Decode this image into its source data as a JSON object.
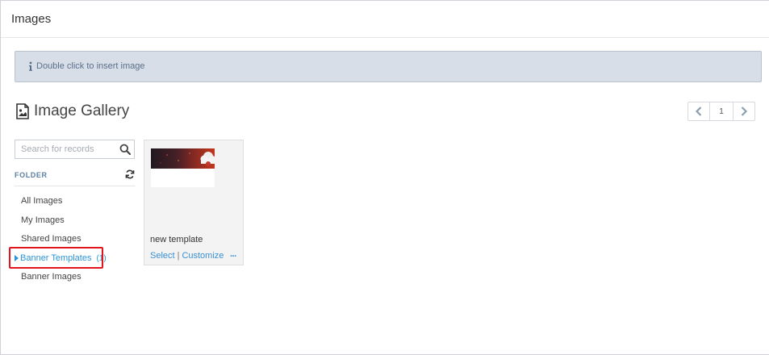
{
  "window": {
    "title": "Images"
  },
  "info": {
    "icon": "info-icon",
    "text": "Double click to insert image"
  },
  "gallery": {
    "icon": "image-icon",
    "title": "Image Gallery"
  },
  "pagination": {
    "current_page": "1",
    "prev_icon": "chevron-left-icon",
    "next_icon": "chevron-right-icon"
  },
  "search": {
    "placeholder": "Search for records",
    "value": "",
    "icon": "search-icon"
  },
  "folders": {
    "heading": "FOLDER",
    "refresh_icon": "refresh-icon",
    "items": [
      {
        "label": "All Images",
        "count": ""
      },
      {
        "label": "My Images",
        "count": ""
      },
      {
        "label": "Shared Images",
        "count": ""
      },
      {
        "label": "Banner Templates",
        "count": "(1)"
      },
      {
        "label": "Banner Images",
        "count": ""
      }
    ],
    "active_index": 3
  },
  "cards": [
    {
      "name": "new template",
      "select_label": "Select",
      "separator": "|",
      "customize_label": "Customize",
      "more_label": "..."
    }
  ],
  "colors": {
    "accent": "#2b94d6",
    "highlight": "#e2141c",
    "info_bg": "#d7dee8"
  }
}
